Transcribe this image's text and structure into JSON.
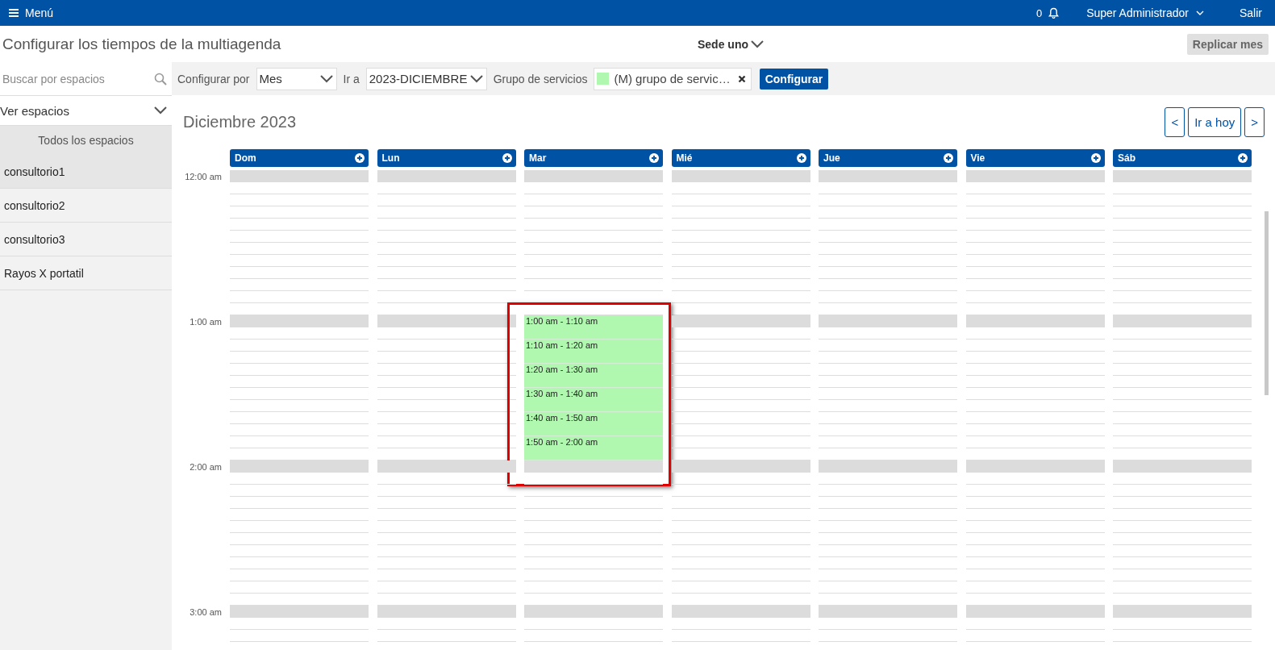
{
  "top_bar": {
    "menu_label": "Menú",
    "notification_count": "0",
    "user": "Super Administrador",
    "logout": "Salir"
  },
  "header": {
    "title": "Configurar los tiempos de la multiagenda",
    "site": "Sede uno",
    "replicate_button": "Replicar mes"
  },
  "sidebar": {
    "search": {
      "placeholder": "Buscar por espacios"
    },
    "filter": {
      "value": "Ver espacios"
    },
    "group_heading": "Todos los espacios",
    "items": [
      {
        "label": "consultorio1",
        "selected": true
      },
      {
        "label": "consultorio2",
        "selected": false
      },
      {
        "label": "consultorio3",
        "selected": false
      },
      {
        "label": "Rayos X portatil",
        "selected": false
      }
    ]
  },
  "toolbar": {
    "configure_by_label": "Configurar por",
    "configure_by": {
      "value": "Mes"
    },
    "go_to_label": "Ir a",
    "go_to": {
      "value": "2023-DICIEMBRE"
    },
    "service_group_label": "Grupo de servicios",
    "service_group": {
      "value": "(M) grupo de servic…"
    },
    "configure_button": "Configurar"
  },
  "calendar": {
    "title": "Diciembre 2023",
    "nav": {
      "previous": "<",
      "today": "Ir a hoy",
      "next": ">"
    },
    "days": [
      {
        "label": "Dom"
      },
      {
        "label": "Lun"
      },
      {
        "label": "Mar"
      },
      {
        "label": "Mié"
      },
      {
        "label": "Jue"
      },
      {
        "label": "Vie"
      },
      {
        "label": "Sáb"
      }
    ],
    "hours": [
      {
        "label": "12:00 am",
        "cells": [
          {
            "kind": "empty"
          },
          {
            "kind": "empty"
          },
          {
            "kind": "empty"
          },
          {
            "kind": "empty"
          },
          {
            "kind": "empty"
          },
          {
            "kind": "empty"
          },
          {
            "kind": "empty"
          }
        ]
      },
      {
        "label": "1:00 am",
        "cells": [
          {
            "kind": "empty"
          },
          {
            "kind": "empty"
          },
          {
            "kind": "slots",
            "highlighted": true,
            "slots": [
              "1:00 am - 1:10 am",
              "1:10 am - 1:20 am",
              "1:20 am - 1:30 am",
              "1:30 am - 1:40 am",
              "1:40 am - 1:50 am",
              "1:50 am - 2:00 am"
            ]
          },
          {
            "kind": "empty"
          },
          {
            "kind": "empty"
          },
          {
            "kind": "empty"
          },
          {
            "kind": "empty"
          }
        ]
      },
      {
        "label": "2:00 am",
        "cells": [
          {
            "kind": "empty"
          },
          {
            "kind": "empty"
          },
          {
            "kind": "empty"
          },
          {
            "kind": "empty"
          },
          {
            "kind": "empty"
          },
          {
            "kind": "empty"
          },
          {
            "kind": "empty"
          }
        ]
      },
      {
        "label": "3:00 am",
        "cells": [
          {
            "kind": "empty"
          },
          {
            "kind": "empty"
          },
          {
            "kind": "empty"
          },
          {
            "kind": "empty"
          },
          {
            "kind": "empty"
          },
          {
            "kind": "empty"
          },
          {
            "kind": "empty"
          }
        ]
      }
    ]
  }
}
